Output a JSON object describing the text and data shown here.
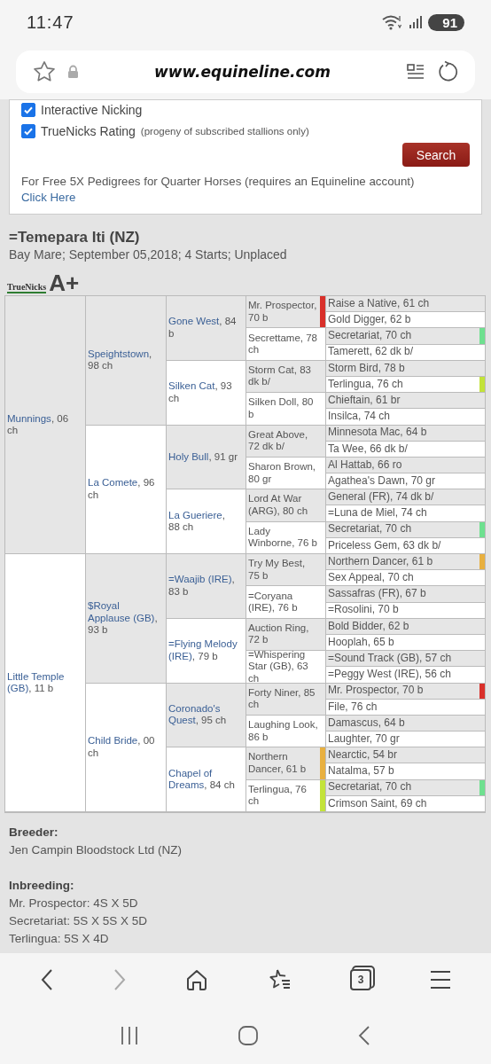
{
  "status_bar": {
    "time": "11:47",
    "battery": "91"
  },
  "browser": {
    "url": "www.equineline.com"
  },
  "search_form": {
    "options": [
      {
        "label": "Interactive Nicking",
        "checked": true
      },
      {
        "label": "TrueNicks Rating",
        "note": "(progeny of subscribed stallions only)",
        "checked": true
      }
    ],
    "search_button": "Search",
    "footnote": "For Free 5X Pedigrees for Quarter Horses (requires an Equineline account)",
    "footnote_link": "Click Here"
  },
  "horse": {
    "name": "=Temepara Iti (NZ)",
    "summary": "Bay Mare; September 05,2018; 4 Starts; Unplaced",
    "logo_text": "TrueNicks",
    "rating": "A+"
  },
  "pedigree": {
    "children": [
      {
        "name": "Munnings",
        "details": ", 06 ch",
        "children": [
          {
            "name": "Speightstown",
            "details": ", 98 ch",
            "children": [
              {
                "name": "Gone West",
                "details": ", 84 b",
                "children": [
                  {
                    "name": "Mr. Prospector",
                    "details": ", 70 b",
                    "color": "#d9302a",
                    "children": [
                      {
                        "name": "Raise a Native",
                        "details": ", 61 ch"
                      },
                      {
                        "name": "Gold Digger",
                        "details": ", 62 b"
                      }
                    ]
                  },
                  {
                    "name": "Secrettame",
                    "details": ", 78 ch",
                    "children": [
                      {
                        "name": "Secretariat",
                        "details": ", 70 ch",
                        "color": "#6ee08f"
                      },
                      {
                        "name": "Tamerett",
                        "details": ", 62 dk b/"
                      }
                    ]
                  }
                ]
              },
              {
                "name": "Silken Cat",
                "details": ", 93 ch",
                "children": [
                  {
                    "name": "Storm Cat",
                    "details": ", 83 dk b/",
                    "children": [
                      {
                        "name": "Storm Bird",
                        "details": ", 78 b"
                      },
                      {
                        "name": "Terlingua",
                        "details": ", 76 ch",
                        "color": "#c3e33a"
                      }
                    ]
                  },
                  {
                    "name": "Silken Doll",
                    "details": ", 80 b",
                    "children": [
                      {
                        "name": "Chieftain",
                        "details": ", 61 br"
                      },
                      {
                        "name": "Insilca",
                        "details": ", 74 ch"
                      }
                    ]
                  }
                ]
              }
            ]
          },
          {
            "name": "La Comete",
            "details": ", 96 ch",
            "children": [
              {
                "name": "Holy Bull",
                "details": ", 91 gr",
                "children": [
                  {
                    "name": "Great Above",
                    "details": ", 72 dk b/",
                    "children": [
                      {
                        "name": "Minnesota Mac",
                        "details": ", 64 b"
                      },
                      {
                        "name": "Ta Wee",
                        "details": ", 66 dk b/"
                      }
                    ]
                  },
                  {
                    "name": "Sharon Brown",
                    "details": ", 80 gr",
                    "children": [
                      {
                        "name": "Al Hattab",
                        "details": ", 66 ro"
                      },
                      {
                        "name": "Agathea's Dawn",
                        "details": ", 70 gr"
                      }
                    ]
                  }
                ]
              },
              {
                "name": "La Gueriere",
                "details": ", 88 ch",
                "children": [
                  {
                    "name": "Lord At War (ARG)",
                    "details": ", 80 ch",
                    "children": [
                      {
                        "name": "General (FR)",
                        "details": ", 74 dk b/"
                      },
                      {
                        "name": "=Luna de Miel",
                        "details": ", 74 ch"
                      }
                    ]
                  },
                  {
                    "name": "Lady Winborne",
                    "details": ", 76 b",
                    "children": [
                      {
                        "name": "Secretariat",
                        "details": ", 70 ch",
                        "color": "#6ee08f"
                      },
                      {
                        "name": "Priceless Gem",
                        "details": ", 63 dk b/"
                      }
                    ]
                  }
                ]
              }
            ]
          }
        ]
      },
      {
        "name": "Little Temple (GB)",
        "details": ", 11 b",
        "children": [
          {
            "name": "$Royal Applause (GB)",
            "details": ", 93 b",
            "children": [
              {
                "name": "=Waajib (IRE)",
                "details": ", 83 b",
                "children": [
                  {
                    "name": "Try My Best",
                    "details": ", 75 b",
                    "children": [
                      {
                        "name": "Northern Dancer",
                        "details": ", 61 b",
                        "color": "#e8b040"
                      },
                      {
                        "name": "Sex Appeal",
                        "details": ", 70 ch"
                      }
                    ]
                  },
                  {
                    "name": "=Coryana (IRE)",
                    "details": ", 76 b",
                    "children": [
                      {
                        "name": "Sassafras (FR)",
                        "details": ", 67 b"
                      },
                      {
                        "name": "=Rosolini",
                        "details": ", 70 b"
                      }
                    ]
                  }
                ]
              },
              {
                "name": "=Flying Melody (IRE)",
                "details": ", 79 b",
                "children": [
                  {
                    "name": "Auction Ring",
                    "details": ", 72 b",
                    "children": [
                      {
                        "name": "Bold Bidder",
                        "details": ", 62 b"
                      },
                      {
                        "name": "Hooplah",
                        "details": ", 65 b"
                      }
                    ]
                  },
                  {
                    "name": "=Whispering Star (GB)",
                    "details": ", 63 ch",
                    "children": [
                      {
                        "name": "=Sound Track (GB)",
                        "details": ", 57 ch"
                      },
                      {
                        "name": "=Peggy West (IRE)",
                        "details": ", 56 ch"
                      }
                    ]
                  }
                ]
              }
            ]
          },
          {
            "name": "Child Bride",
            "details": ", 00 ch",
            "children": [
              {
                "name": "Coronado's Quest",
                "details": ", 95 ch",
                "children": [
                  {
                    "name": "Forty Niner",
                    "details": ", 85 ch",
                    "children": [
                      {
                        "name": "Mr. Prospector",
                        "details": ", 70 b",
                        "color": "#d9302a"
                      },
                      {
                        "name": "File",
                        "details": ", 76 ch"
                      }
                    ]
                  },
                  {
                    "name": "Laughing Look",
                    "details": ", 86 b",
                    "children": [
                      {
                        "name": "Damascus",
                        "details": ", 64 b"
                      },
                      {
                        "name": "Laughter",
                        "details": ", 70 gr"
                      }
                    ]
                  }
                ]
              },
              {
                "name": "Chapel of Dreams",
                "details": ", 84 ch",
                "children": [
                  {
                    "name": "Northern Dancer",
                    "details": ", 61 b",
                    "color": "#e8b040",
                    "children": [
                      {
                        "name": "Nearctic",
                        "details": ", 54 br"
                      },
                      {
                        "name": "Natalma",
                        "details": ", 57 b"
                      }
                    ]
                  },
                  {
                    "name": "Terlingua",
                    "details": ", 76 ch",
                    "color": "#c3e33a",
                    "children": [
                      {
                        "name": "Secretariat",
                        "details": ", 70 ch",
                        "color": "#6ee08f"
                      },
                      {
                        "name": "Crimson Saint",
                        "details": ", 69 ch"
                      }
                    ]
                  }
                ]
              }
            ]
          }
        ]
      }
    ]
  },
  "breeder": {
    "label": "Breeder:",
    "value": "Jen Campin Bloodstock Ltd (NZ)"
  },
  "inbreeding": {
    "label": "Inbreeding:",
    "lines": [
      "Mr. Prospector: 4S X 5D",
      "Secretariat: 5S X 5S X 5D",
      "Terlingua: 5S X 4D"
    ]
  },
  "nav": {
    "forward_enabled": false,
    "tab_count": "3"
  }
}
